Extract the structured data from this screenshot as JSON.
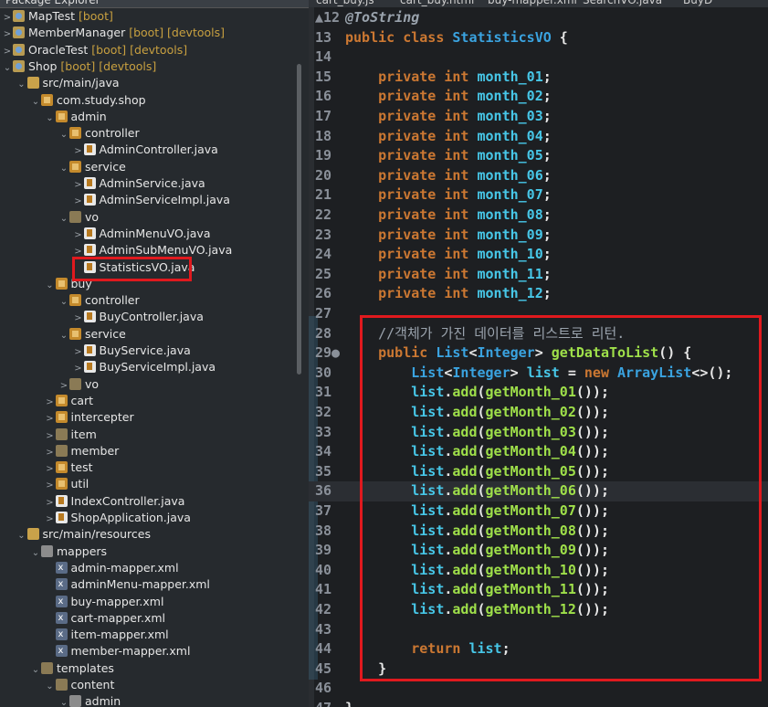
{
  "explorer": {
    "title": "Package Explorer",
    "rows": [
      {
        "indent": 0,
        "tw": ">",
        "icon": "proj",
        "label": "MapTest",
        "tag": "[boot]"
      },
      {
        "indent": 0,
        "tw": ">",
        "icon": "proj",
        "label": "MemberManager",
        "tag": "[boot] [devtools]"
      },
      {
        "indent": 0,
        "tw": ">",
        "icon": "proj",
        "label": "OracleTest",
        "tag": "[boot] [devtools]"
      },
      {
        "indent": 0,
        "tw": "⌄",
        "icon": "proj",
        "label": "Shop",
        "tag": "[boot] [devtools]"
      },
      {
        "indent": 1,
        "tw": "⌄",
        "icon": "srcf",
        "label": "src/main/java",
        "tag": ""
      },
      {
        "indent": 2,
        "tw": "⌄",
        "icon": "pkg",
        "label": "com.study.shop",
        "tag": ""
      },
      {
        "indent": 3,
        "tw": "⌄",
        "icon": "pkg",
        "label": "admin",
        "tag": ""
      },
      {
        "indent": 4,
        "tw": "⌄",
        "icon": "pkg",
        "label": "controller",
        "tag": ""
      },
      {
        "indent": 5,
        "tw": ">",
        "icon": "java",
        "label": "AdminController.java",
        "tag": ""
      },
      {
        "indent": 4,
        "tw": "⌄",
        "icon": "pkg",
        "label": "service",
        "tag": ""
      },
      {
        "indent": 5,
        "tw": ">",
        "icon": "java",
        "label": "AdminService.java",
        "tag": ""
      },
      {
        "indent": 5,
        "tw": ">",
        "icon": "java",
        "label": "AdminServiceImpl.java",
        "tag": ""
      },
      {
        "indent": 4,
        "tw": "⌄",
        "icon": "emp",
        "label": "vo",
        "tag": ""
      },
      {
        "indent": 5,
        "tw": ">",
        "icon": "java",
        "label": "AdminMenuVO.java",
        "tag": ""
      },
      {
        "indent": 5,
        "tw": ">",
        "icon": "java",
        "label": "AdminSubMenuVO.java",
        "tag": ""
      },
      {
        "indent": 5,
        "tw": "",
        "icon": "java",
        "label": "StatisticsVO.java",
        "tag": ""
      },
      {
        "indent": 3,
        "tw": "⌄",
        "icon": "pkg",
        "label": "buy",
        "tag": ""
      },
      {
        "indent": 4,
        "tw": "⌄",
        "icon": "pkg",
        "label": "controller",
        "tag": ""
      },
      {
        "indent": 5,
        "tw": ">",
        "icon": "java",
        "label": "BuyController.java",
        "tag": ""
      },
      {
        "indent": 4,
        "tw": "⌄",
        "icon": "pkg",
        "label": "service",
        "tag": ""
      },
      {
        "indent": 5,
        "tw": ">",
        "icon": "java",
        "label": "BuyService.java",
        "tag": ""
      },
      {
        "indent": 5,
        "tw": ">",
        "icon": "java",
        "label": "BuyServiceImpl.java",
        "tag": ""
      },
      {
        "indent": 4,
        "tw": ">",
        "icon": "emp",
        "label": "vo",
        "tag": ""
      },
      {
        "indent": 3,
        "tw": ">",
        "icon": "pkg",
        "label": "cart",
        "tag": ""
      },
      {
        "indent": 3,
        "tw": ">",
        "icon": "pkg",
        "label": "intercepter",
        "tag": ""
      },
      {
        "indent": 3,
        "tw": ">",
        "icon": "emp",
        "label": "item",
        "tag": ""
      },
      {
        "indent": 3,
        "tw": ">",
        "icon": "emp",
        "label": "member",
        "tag": ""
      },
      {
        "indent": 3,
        "tw": ">",
        "icon": "pkg",
        "label": "test",
        "tag": ""
      },
      {
        "indent": 3,
        "tw": ">",
        "icon": "pkg",
        "label": "util",
        "tag": ""
      },
      {
        "indent": 3,
        "tw": ">",
        "icon": "java",
        "label": "IndexController.java",
        "tag": ""
      },
      {
        "indent": 3,
        "tw": ">",
        "icon": "java",
        "label": "ShopApplication.java",
        "tag": ""
      },
      {
        "indent": 1,
        "tw": "⌄",
        "icon": "srcf",
        "label": "src/main/resources",
        "tag": ""
      },
      {
        "indent": 2,
        "tw": "⌄",
        "icon": "fold",
        "label": "mappers",
        "tag": ""
      },
      {
        "indent": 3,
        "tw": "",
        "icon": "xml",
        "label": "admin-mapper.xml",
        "tag": ""
      },
      {
        "indent": 3,
        "tw": "",
        "icon": "xml",
        "label": "adminMenu-mapper.xml",
        "tag": ""
      },
      {
        "indent": 3,
        "tw": "",
        "icon": "xml",
        "label": "buy-mapper.xml",
        "tag": ""
      },
      {
        "indent": 3,
        "tw": "",
        "icon": "xml",
        "label": "cart-mapper.xml",
        "tag": ""
      },
      {
        "indent": 3,
        "tw": "",
        "icon": "xml",
        "label": "item-mapper.xml",
        "tag": ""
      },
      {
        "indent": 3,
        "tw": "",
        "icon": "xml",
        "label": "member-mapper.xml",
        "tag": ""
      },
      {
        "indent": 2,
        "tw": "⌄",
        "icon": "emp",
        "label": "templates",
        "tag": ""
      },
      {
        "indent": 3,
        "tw": "⌄",
        "icon": "emp",
        "label": "content",
        "tag": ""
      },
      {
        "indent": 4,
        "tw": "⌄",
        "icon": "fold",
        "label": "admin",
        "tag": ""
      }
    ]
  },
  "editor": {
    "tabs": [
      "cart_buy.js",
      "cart_buy.html",
      "buy-mapper.xml",
      "SearchVO.java",
      "BuyD"
    ],
    "lines": [
      {
        "n": "12",
        "marker": "▲",
        "segs": [
          [
            "a",
            "@ToString"
          ]
        ]
      },
      {
        "n": "13",
        "marker": "",
        "segs": [
          [
            "k",
            "public class "
          ],
          [
            "t",
            "StatisticsVO"
          ],
          [
            "p",
            " {"
          ]
        ]
      },
      {
        "n": "14",
        "marker": "",
        "segs": []
      },
      {
        "n": "15",
        "marker": "",
        "segs": [
          [
            "p",
            "    "
          ],
          [
            "k",
            "private int "
          ],
          [
            "f",
            "month_01"
          ],
          [
            "p",
            ";"
          ]
        ]
      },
      {
        "n": "16",
        "marker": "",
        "segs": [
          [
            "p",
            "    "
          ],
          [
            "k",
            "private int "
          ],
          [
            "f",
            "month_02"
          ],
          [
            "p",
            ";"
          ]
        ]
      },
      {
        "n": "17",
        "marker": "",
        "segs": [
          [
            "p",
            "    "
          ],
          [
            "k",
            "private int "
          ],
          [
            "f",
            "month_03"
          ],
          [
            "p",
            ";"
          ]
        ]
      },
      {
        "n": "18",
        "marker": "",
        "segs": [
          [
            "p",
            "    "
          ],
          [
            "k",
            "private int "
          ],
          [
            "f",
            "month_04"
          ],
          [
            "p",
            ";"
          ]
        ]
      },
      {
        "n": "19",
        "marker": "",
        "segs": [
          [
            "p",
            "    "
          ],
          [
            "k",
            "private int "
          ],
          [
            "f",
            "month_05"
          ],
          [
            "p",
            ";"
          ]
        ]
      },
      {
        "n": "20",
        "marker": "",
        "segs": [
          [
            "p",
            "    "
          ],
          [
            "k",
            "private int "
          ],
          [
            "f",
            "month_06"
          ],
          [
            "p",
            ";"
          ]
        ]
      },
      {
        "n": "21",
        "marker": "",
        "segs": [
          [
            "p",
            "    "
          ],
          [
            "k",
            "private int "
          ],
          [
            "f",
            "month_07"
          ],
          [
            "p",
            ";"
          ]
        ]
      },
      {
        "n": "22",
        "marker": "",
        "segs": [
          [
            "p",
            "    "
          ],
          [
            "k",
            "private int "
          ],
          [
            "f",
            "month_08"
          ],
          [
            "p",
            ";"
          ]
        ]
      },
      {
        "n": "23",
        "marker": "",
        "segs": [
          [
            "p",
            "    "
          ],
          [
            "k",
            "private int "
          ],
          [
            "f",
            "month_09"
          ],
          [
            "p",
            ";"
          ]
        ]
      },
      {
        "n": "24",
        "marker": "",
        "segs": [
          [
            "p",
            "    "
          ],
          [
            "k",
            "private int "
          ],
          [
            "f",
            "month_10"
          ],
          [
            "p",
            ";"
          ]
        ]
      },
      {
        "n": "25",
        "marker": "",
        "segs": [
          [
            "p",
            "    "
          ],
          [
            "k",
            "private int "
          ],
          [
            "f",
            "month_11"
          ],
          [
            "p",
            ";"
          ]
        ]
      },
      {
        "n": "26",
        "marker": "",
        "segs": [
          [
            "p",
            "    "
          ],
          [
            "k",
            "private int "
          ],
          [
            "f",
            "month_12"
          ],
          [
            "p",
            ";"
          ]
        ]
      },
      {
        "n": "27",
        "marker": "",
        "segs": []
      },
      {
        "n": "28",
        "marker": "",
        "segs": [
          [
            "p",
            "    "
          ],
          [
            "c",
            "//객체가 가진 데이터를 리스트로 리턴."
          ]
        ]
      },
      {
        "n": "29",
        "marker": "●",
        "segs": [
          [
            "p",
            "    "
          ],
          [
            "k",
            "public "
          ],
          [
            "t",
            "List"
          ],
          [
            "p",
            "<"
          ],
          [
            "t",
            "Integer"
          ],
          [
            "p",
            "> "
          ],
          [
            "m",
            "getDataToList"
          ],
          [
            "p",
            "() {"
          ]
        ]
      },
      {
        "n": "30",
        "marker": "",
        "segs": [
          [
            "p",
            "        "
          ],
          [
            "t",
            "List"
          ],
          [
            "p",
            "<"
          ],
          [
            "t",
            "Integer"
          ],
          [
            "p",
            "> "
          ],
          [
            "f",
            "list"
          ],
          [
            "p",
            " = "
          ],
          [
            "k",
            "new "
          ],
          [
            "t",
            "ArrayList"
          ],
          [
            "p",
            "<>();"
          ]
        ]
      },
      {
        "n": "31",
        "marker": "",
        "segs": [
          [
            "p",
            "        "
          ],
          [
            "f",
            "list"
          ],
          [
            "p",
            "."
          ],
          [
            "m",
            "add"
          ],
          [
            "p",
            "("
          ],
          [
            "m",
            "getMonth_01"
          ],
          [
            "p",
            "());"
          ]
        ]
      },
      {
        "n": "32",
        "marker": "",
        "segs": [
          [
            "p",
            "        "
          ],
          [
            "f",
            "list"
          ],
          [
            "p",
            "."
          ],
          [
            "m",
            "add"
          ],
          [
            "p",
            "("
          ],
          [
            "m",
            "getMonth_02"
          ],
          [
            "p",
            "());"
          ]
        ]
      },
      {
        "n": "33",
        "marker": "",
        "segs": [
          [
            "p",
            "        "
          ],
          [
            "f",
            "list"
          ],
          [
            "p",
            "."
          ],
          [
            "m",
            "add"
          ],
          [
            "p",
            "("
          ],
          [
            "m",
            "getMonth_03"
          ],
          [
            "p",
            "());"
          ]
        ]
      },
      {
        "n": "34",
        "marker": "",
        "segs": [
          [
            "p",
            "        "
          ],
          [
            "f",
            "list"
          ],
          [
            "p",
            "."
          ],
          [
            "m",
            "add"
          ],
          [
            "p",
            "("
          ],
          [
            "m",
            "getMonth_04"
          ],
          [
            "p",
            "());"
          ]
        ]
      },
      {
        "n": "35",
        "marker": "",
        "segs": [
          [
            "p",
            "        "
          ],
          [
            "f",
            "list"
          ],
          [
            "p",
            "."
          ],
          [
            "m",
            "add"
          ],
          [
            "p",
            "("
          ],
          [
            "m",
            "getMonth_05"
          ],
          [
            "p",
            "());"
          ]
        ]
      },
      {
        "n": "36",
        "marker": "",
        "segs": [
          [
            "p",
            "        "
          ],
          [
            "f",
            "list"
          ],
          [
            "p",
            "."
          ],
          [
            "m",
            "add"
          ],
          [
            "p",
            "("
          ],
          [
            "m",
            "getMonth_06"
          ],
          [
            "p",
            "());"
          ]
        ]
      },
      {
        "n": "37",
        "marker": "",
        "segs": [
          [
            "p",
            "        "
          ],
          [
            "f",
            "list"
          ],
          [
            "p",
            "."
          ],
          [
            "m",
            "add"
          ],
          [
            "p",
            "("
          ],
          [
            "m",
            "getMonth_07"
          ],
          [
            "p",
            "());"
          ]
        ]
      },
      {
        "n": "38",
        "marker": "",
        "segs": [
          [
            "p",
            "        "
          ],
          [
            "f",
            "list"
          ],
          [
            "p",
            "."
          ],
          [
            "m",
            "add"
          ],
          [
            "p",
            "("
          ],
          [
            "m",
            "getMonth_08"
          ],
          [
            "p",
            "());"
          ]
        ]
      },
      {
        "n": "39",
        "marker": "",
        "segs": [
          [
            "p",
            "        "
          ],
          [
            "f",
            "list"
          ],
          [
            "p",
            "."
          ],
          [
            "m",
            "add"
          ],
          [
            "p",
            "("
          ],
          [
            "m",
            "getMonth_09"
          ],
          [
            "p",
            "());"
          ]
        ]
      },
      {
        "n": "40",
        "marker": "",
        "segs": [
          [
            "p",
            "        "
          ],
          [
            "f",
            "list"
          ],
          [
            "p",
            "."
          ],
          [
            "m",
            "add"
          ],
          [
            "p",
            "("
          ],
          [
            "m",
            "getMonth_10"
          ],
          [
            "p",
            "());"
          ]
        ]
      },
      {
        "n": "41",
        "marker": "",
        "segs": [
          [
            "p",
            "        "
          ],
          [
            "f",
            "list"
          ],
          [
            "p",
            "."
          ],
          [
            "m",
            "add"
          ],
          [
            "p",
            "("
          ],
          [
            "m",
            "getMonth_11"
          ],
          [
            "p",
            "());"
          ]
        ]
      },
      {
        "n": "42",
        "marker": "",
        "segs": [
          [
            "p",
            "        "
          ],
          [
            "f",
            "list"
          ],
          [
            "p",
            "."
          ],
          [
            "m",
            "add"
          ],
          [
            "p",
            "("
          ],
          [
            "m",
            "getMonth_12"
          ],
          [
            "p",
            "());"
          ]
        ]
      },
      {
        "n": "43",
        "marker": "",
        "segs": []
      },
      {
        "n": "44",
        "marker": "",
        "segs": [
          [
            "p",
            "        "
          ],
          [
            "k",
            "return "
          ],
          [
            "f",
            "list"
          ],
          [
            "p",
            ";"
          ]
        ]
      },
      {
        "n": "45",
        "marker": "",
        "segs": [
          [
            "p",
            "    }"
          ]
        ]
      },
      {
        "n": "46",
        "marker": "",
        "segs": []
      },
      {
        "n": "47",
        "marker": "",
        "segs": [
          [
            "p",
            "}"
          ]
        ]
      }
    ],
    "current_line": "36"
  },
  "colors": {
    "highlight_box": "#e0191e"
  }
}
